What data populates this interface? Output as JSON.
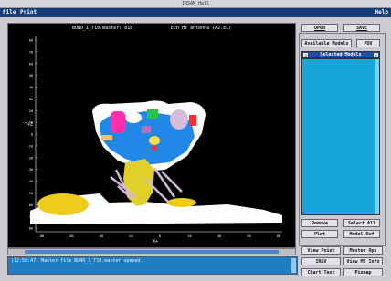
{
  "window": {
    "title": "IRSAM Hall"
  },
  "menu": {
    "file": "File",
    "print": "Print",
    "help": "Help"
  },
  "plot": {
    "header_left": "BUNO_1_T10.master: 818",
    "header_right": "Ech Hz antenna (A2.EL)",
    "y_axis_label": "Y+Z",
    "x_axis_label": "X+",
    "y_ticks": [
      "80",
      "70",
      "60",
      "50",
      "40",
      "30",
      "20",
      "10",
      "0",
      "-10",
      "-20",
      "-30",
      "-40",
      "-50",
      "-60",
      "-70",
      "-80"
    ],
    "x_ticks": [
      "-80",
      "-60",
      "-40",
      "-20",
      "0",
      "20",
      "40",
      "60",
      "80"
    ]
  },
  "buttons": {
    "open": "OPEN",
    "save": "SAVE",
    "available_models": "Available Models",
    "pov": "POV",
    "remove": "Remove",
    "select_all": "Select All",
    "plot": "Plot",
    "model_ref": "Model Ref",
    "view_point": "View Point",
    "master_ops": "Master Ops",
    "insv": "INSV",
    "view_ms_info": "View MS Info",
    "chart_text": "Chart Text",
    "pixmap": "Pixmap"
  },
  "selected_models": {
    "label": "Selected Models",
    "items": []
  },
  "status": {
    "message": "(12:58:47) Master file BUNO_1_T10.master opened."
  },
  "colors": {
    "menubar": "#143c78",
    "list_bg": "#16a6d8",
    "message_bg": "#1f7ec2",
    "plot_bg": "#000000"
  }
}
